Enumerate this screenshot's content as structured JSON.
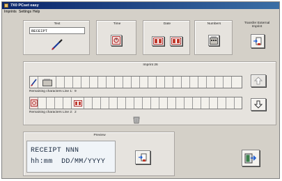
{
  "window": {
    "title": "7X0 PCset easy"
  },
  "menu": [
    "Imprints",
    "Settings",
    "Help"
  ],
  "toolbox": {
    "text_label": "Text",
    "text_value": "RECEIPT",
    "time_label": "Time",
    "date_label": "Date",
    "numbers_label": "Numbers",
    "transfer_label_line1": "Transfer External",
    "transfer_label_line2": "Imprint"
  },
  "imprint": {
    "title": "Imprint 26",
    "line1_remaining": "Remaining characters Line 1:  9",
    "line2_remaining": "Remaining characters Line 2:  2"
  },
  "preview": {
    "title": "Preview",
    "line1": "RECEIPT NNN",
    "line2": "hh:mm  DD/MM/YYYY"
  },
  "colors": {
    "titlebar": "#0a246a",
    "panel": "#d4d0c8",
    "icon_red": "#c0392b"
  }
}
